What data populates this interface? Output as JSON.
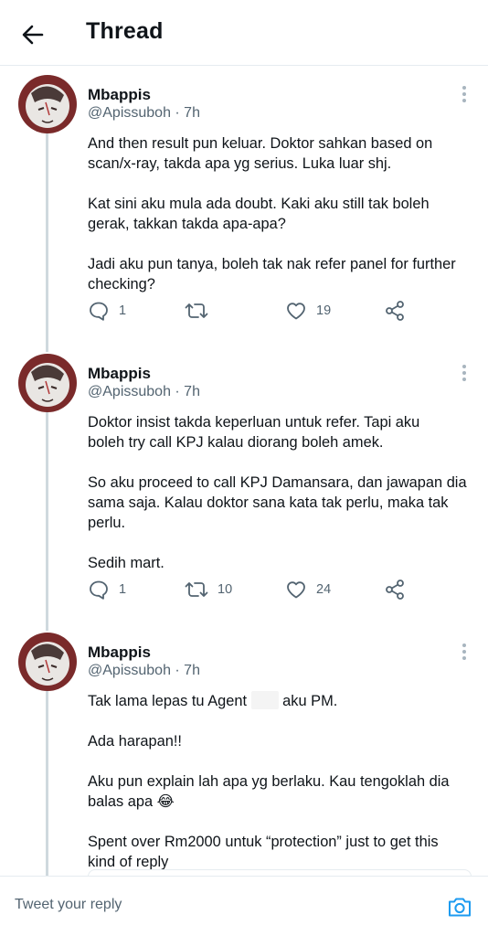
{
  "header": {
    "title": "Thread",
    "back_icon": "arrow-left-icon"
  },
  "tweets": [
    {
      "name": "Mbappis",
      "handle": "@Apissuboh",
      "time": "7h",
      "meta": "@Apissuboh · 7h",
      "lines": [
        "And then result pun keluar. Doktor sahkan based on",
        "scan/x-ray, takda apa yg serius. Luka luar shj.",
        "Kat sini aku mula ada doubt. Kaki aku still tak boleh",
        "gerak, takkan takda apa-apa?",
        "Jadi aku pun tanya, boleh tak nak refer panel for further",
        "checking?"
      ],
      "replies": "1",
      "retweets": "",
      "likes": "19"
    },
    {
      "name": "Mbappis",
      "handle": "@Apissuboh",
      "time": "7h",
      "meta": "@Apissuboh · 7h",
      "lines": [
        "Doktor insist takda keperluan untuk refer. Tapi aku",
        "boleh try call KPJ kalau diorang boleh amek.",
        "So aku proceed to call KPJ Damansara, dan jawapan dia",
        "sama saja. Kalau doktor sana kata tak perlu, maka tak",
        "perlu.",
        "Sedih mart."
      ],
      "replies": "1",
      "retweets": "10",
      "likes": "24"
    },
    {
      "name": "Mbappis",
      "handle": "@Apissuboh",
      "time": "7h",
      "meta": "@Apissuboh · 7h",
      "lines": [
        "Tak lama lepas tu Agent",
        "aku PM.",
        "Ada harapan!!",
        "Aku pun explain lah apa yg berlaku. Kau tengoklah dia",
        "balas apa 😂",
        "Spent over Rm2000 untuk “protection” just to get this",
        "kind of reply"
      ]
    }
  ],
  "reply_bar": {
    "placeholder": "Tweet your reply",
    "camera_icon": "camera-icon"
  },
  "colors": {
    "text": "#0f1419",
    "secondary": "#536471",
    "accent": "#1d9bf0",
    "divider": "#e6ecf0"
  }
}
